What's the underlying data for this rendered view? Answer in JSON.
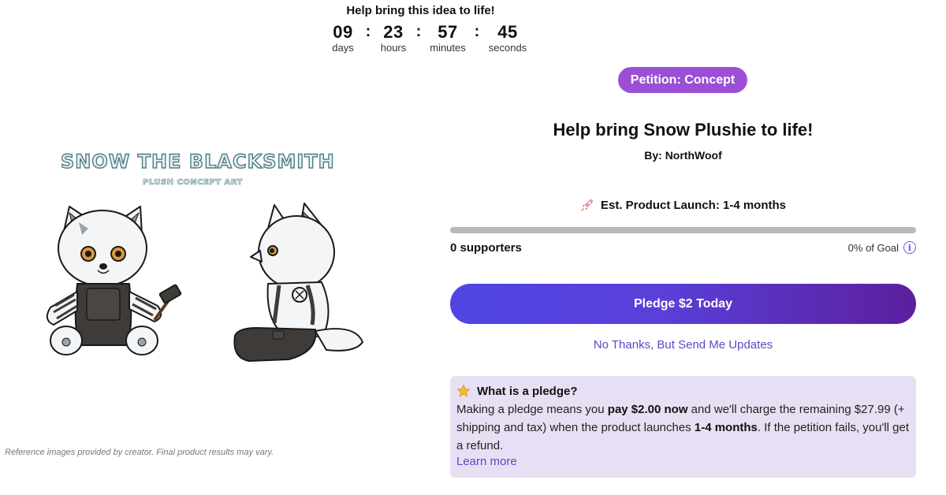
{
  "countdown": {
    "title": "Help bring this idea to life!",
    "days": "09",
    "days_label": "days",
    "hours": "23",
    "hours_label": "hours",
    "minutes": "57",
    "minutes_label": "minutes",
    "seconds": "45",
    "seconds_label": "seconds",
    "separator": ":"
  },
  "art": {
    "title": "SNOW THE BLACKSMITH",
    "subtitle": "PLUSH CONCEPT ART",
    "disclaimer": "Reference images provided by creator. Final product results may vary."
  },
  "campaign": {
    "badge": "Petition: Concept",
    "badge_color": "#9b4fd6",
    "title": "Help bring Snow Plushie to life!",
    "byline": "By: NorthWoof",
    "launch_icon": "rocket-icon",
    "launch_text": "Est. Product Launch: 1-4 months",
    "progress_fraction": 0,
    "supporters": "0 supporters",
    "goal_text": "0% of Goal",
    "pledge_button": "Pledge $2 Today",
    "no_thanks": "No Thanks, But Send Me Updates"
  },
  "pledge_info": {
    "icon": "star-icon",
    "heading": "What is a pledge?",
    "text_1": "Making a pledge means you ",
    "bold_1": "pay $2.00 now",
    "text_2": " and we'll charge the remaining $27.99 (+ shipping and tax) when the product launches ",
    "bold_2": "1-4 months",
    "text_3": ". If the petition fails, you'll get a refund.",
    "learn_more": "Learn more"
  },
  "colors": {
    "accent": "#5a48c8",
    "info_bg": "#e7e0f4",
    "progress_track": "#b9b9b9"
  }
}
